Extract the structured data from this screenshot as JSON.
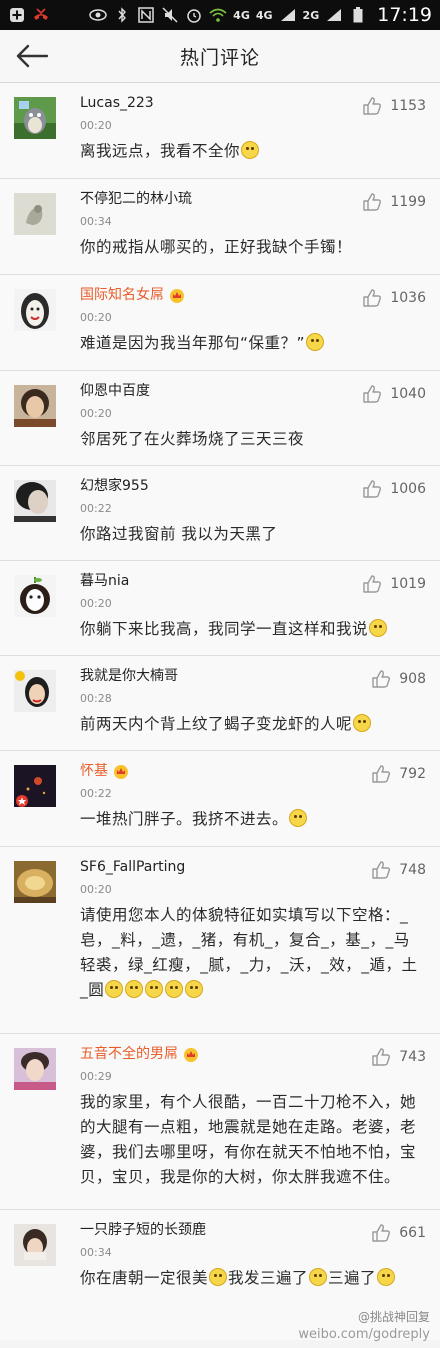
{
  "statusbar": {
    "network_4g_a": "4G",
    "network_4g_b": "4G",
    "network_2g": "2G",
    "time": "17:19"
  },
  "header": {
    "title": "热门评论"
  },
  "comments": [
    {
      "name": "Lucas_223",
      "time": "00:20",
      "text": "离我远点，我看不全你",
      "likes": "1153",
      "vip": false,
      "emojis": 1
    },
    {
      "name": "不停犯二的林小琉",
      "time": "00:34",
      "text": "你的戒指从哪买的，正好我缺个手镯！",
      "likes": "1199",
      "vip": false,
      "emojis": 0
    },
    {
      "name": "国际知名女屌",
      "time": "00:20",
      "text": "难道是因为我当年那句“保重？”",
      "likes": "1036",
      "vip": true,
      "emojis": 1
    },
    {
      "name": "仰恩中百度",
      "time": "00:20",
      "text": "邻居死了在火葬场烧了三天三夜",
      "likes": "1040",
      "vip": false,
      "emojis": 0
    },
    {
      "name": "幻想家955",
      "time": "00:22",
      "text": "你路过我窗前 我以为天黑了",
      "likes": "1006",
      "vip": false,
      "emojis": 0
    },
    {
      "name": "暮马nia",
      "time": "00:20",
      "text": "你躺下来比我高，我同学一直这样和我说",
      "likes": "1019",
      "vip": false,
      "emojis": 1
    },
    {
      "name": "我就是你大楠哥",
      "time": "00:28",
      "text": "前两天内个背上纹了蝎子变龙虾的人呢",
      "likes": "908",
      "vip": false,
      "emojis": 1
    },
    {
      "name": "怀基",
      "time": "00:22",
      "text": "一堆热门胖子。我挤不进去。",
      "likes": "792",
      "vip": true,
      "emojis": 1
    },
    {
      "name": "SF6_FallParting",
      "time": "00:20",
      "text": "请使用您本人的体貌特征如实填写以下空格：_皂，_料，_遗，_猪，有机_，复合_，基_，_马轻裘，绿_红瘦，_腻，_力，_沃，_效，_遁，土_圆",
      "likes": "748",
      "vip": false,
      "emojis": 5
    },
    {
      "name": "五音不全的男屌",
      "time": "00:29",
      "text": "我的家里，有个人很酷，一百二十刀枪不入，她的大腿有一点粗，地震就是她在走路。老婆，老婆，我们去哪里呀，有你在就天不怕地不怕，宝贝，宝贝，我是你的大树，你太胖我遮不住。",
      "likes": "743",
      "vip": true,
      "emojis": 0
    },
    {
      "name": "一只脖子短的长颈鹿",
      "time": "00:34",
      "text": "你在唐朝一定很美",
      "text2": "我发三遍了",
      "text3": "三遍了",
      "likes": "661",
      "vip": false,
      "emojis": 0
    }
  ],
  "watermark": {
    "line1": "@挑战神回复",
    "line2": "weibo.com/godreply"
  },
  "colors": {
    "vip_name": "#e85d2a",
    "divider": "#dedede"
  }
}
